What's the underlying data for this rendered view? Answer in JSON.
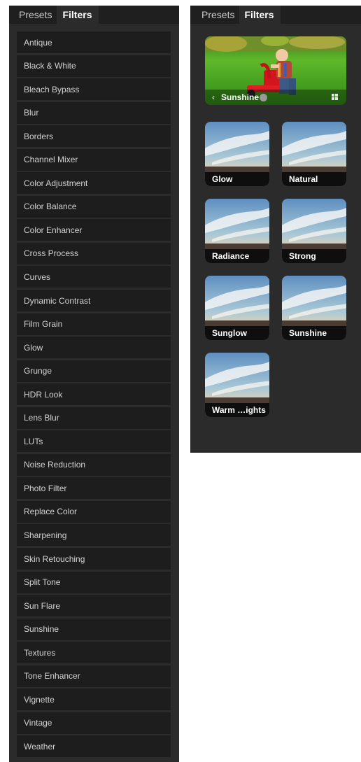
{
  "left_panel": {
    "tabs": [
      {
        "label": "Presets",
        "active": false
      },
      {
        "label": "Filters",
        "active": true
      }
    ],
    "filters": [
      "Antique",
      "Black & White",
      "Bleach Bypass",
      "Blur",
      "Borders",
      "Channel Mixer",
      "Color Adjustment",
      "Color Balance",
      "Color Enhancer",
      "Cross Process",
      "Curves",
      "Dynamic Contrast",
      "Film Grain",
      "Glow",
      "Grunge",
      "HDR Look",
      "Lens Blur",
      "LUTs",
      "Noise Reduction",
      "Photo Filter",
      "Replace Color",
      "Sharpening",
      "Skin Retouching",
      "Split Tone",
      "Sun Flare",
      "Sunshine",
      "Textures",
      "Tone Enhancer",
      "Vignette",
      "Vintage",
      "Weather"
    ]
  },
  "right_panel": {
    "tabs": [
      {
        "label": "Presets",
        "active": false
      },
      {
        "label": "Filters",
        "active": true
      }
    ],
    "current_filter": {
      "back_glyph": "‹",
      "name": "Sunshine",
      "icon": "grid-view-icon"
    },
    "presets": [
      "Glow",
      "Natural",
      "Radiance",
      "Strong",
      "Sunglow",
      "Sunshine",
      "Warm …ights"
    ]
  },
  "colors": {
    "panel_bg": "#2b2b2b",
    "tab_bar_bg": "#1f1f1f",
    "list_item_bg": "#1d1d1d",
    "list_text": "#d3d3d3"
  }
}
